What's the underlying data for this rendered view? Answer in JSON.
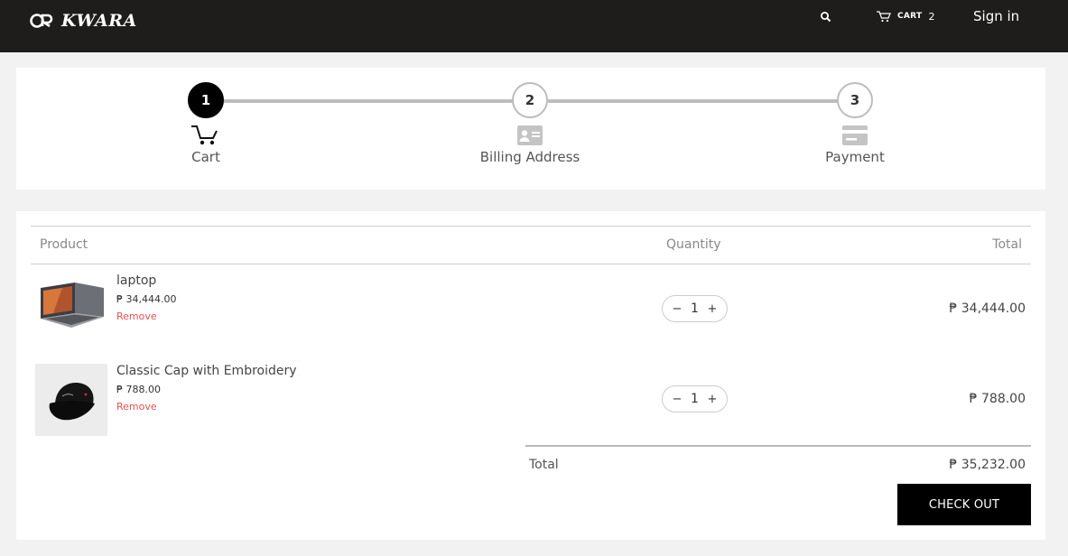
{
  "header": {
    "logo_text": "KWARA",
    "cart_label": "CART",
    "cart_count": "2",
    "signin_label": "Sign in",
    "background": "#1f1c1c"
  },
  "steps": [
    {
      "number": "1",
      "label": "Cart",
      "icon": "shopping-cart-icon",
      "state": "active"
    },
    {
      "number": "2",
      "label": "Billing Address",
      "icon": "id-card-icon",
      "state": "pending"
    },
    {
      "number": "3",
      "label": "Payment",
      "icon": "credit-card-icon",
      "state": "pending"
    }
  ],
  "table": {
    "headers": {
      "product": "Product",
      "quantity": "Quantity",
      "total": "Total"
    },
    "items": [
      {
        "name": "laptop",
        "price": "₱ 34,444.00",
        "remove": "Remove",
        "quantity": "1",
        "line_total": "₱ 34,444.00",
        "image": "laptop-image"
      },
      {
        "name": "Classic Cap with Embroidery",
        "price": "₱ 788.00",
        "remove": "Remove",
        "quantity": "1",
        "line_total": "₱ 788.00",
        "image": "cap-image"
      }
    ],
    "decrement_symbol": "−",
    "increment_symbol": "+"
  },
  "summary": {
    "total_label": "Total",
    "total_value": "₱ 35,232.00",
    "checkout_label": "CHECK OUT"
  },
  "colors": {
    "accent": "#000000",
    "remove_link": "#e05252",
    "step_line": "#bdbdbd"
  }
}
